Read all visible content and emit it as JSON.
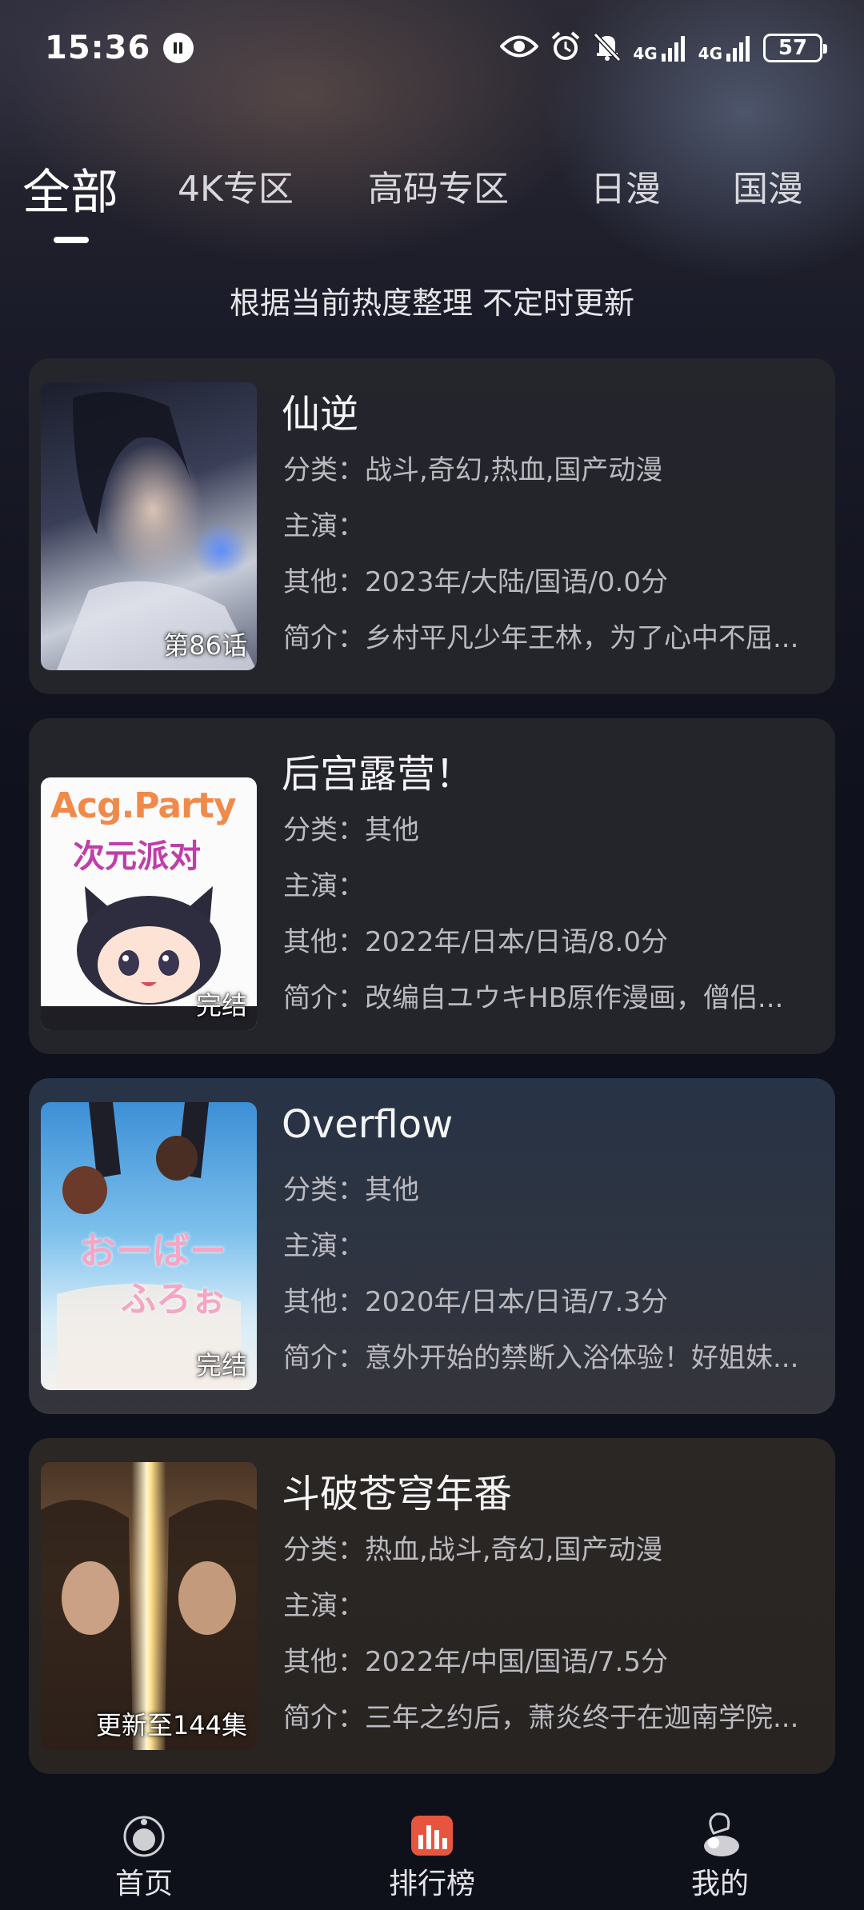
{
  "status_bar": {
    "time": "15:36",
    "network_1": "4G",
    "network_2": "4G",
    "battery": "57"
  },
  "tabs": [
    {
      "label": "全部"
    },
    {
      "label": "4K专区"
    },
    {
      "label": "高码专区"
    },
    {
      "label": "日漫"
    },
    {
      "label": "国漫"
    }
  ],
  "subtitle": "根据当前热度整理 不定时更新",
  "items": [
    {
      "title": "仙逆",
      "badge": "第86话",
      "category": "分类：战斗,奇幻,热血,国产动漫",
      "cast": "主演：",
      "other": "其他：2023年/大陆/国语/0.0分",
      "intro": "简介：乡村平凡少年王林，为了心中不屈..."
    },
    {
      "title": "后宫露营！",
      "badge": "完结",
      "poster_text_1": "Acg.Party",
      "poster_text_2": "次元派对",
      "category": "分类：其他",
      "cast": "主演：",
      "other": "其他：2022年/日本/日语/8.0分",
      "intro": "简介：改编自ユウキHB原作漫画，僧侣..."
    },
    {
      "title": "Overflow",
      "badge": "完结",
      "poster_text_1": "おーばー",
      "poster_text_2": "ふろぉ",
      "category": "分类：其他",
      "cast": "主演：",
      "other": "其他：2020年/日本/日语/7.3分",
      "intro": "简介：意外开始的禁断入浴体验！好姐妹..."
    },
    {
      "title": "斗破苍穹年番",
      "badge": "更新至144集",
      "category": "分类：热血,战斗,奇幻,国产动漫",
      "cast": "主演：",
      "other": "其他：2022年/中国/国语/7.5分",
      "intro": "简介：三年之约后，萧炎终于在迦南学院..."
    }
  ],
  "nav": [
    {
      "label": "首页",
      "icon": "home-icon"
    },
    {
      "label": "排行榜",
      "icon": "ranking-icon"
    },
    {
      "label": "我的",
      "icon": "profile-icon"
    }
  ],
  "colors": {
    "background": "#121420",
    "card": "#26262c",
    "accent_active": "#ffffff",
    "ranking_icon": "#e8553f"
  }
}
